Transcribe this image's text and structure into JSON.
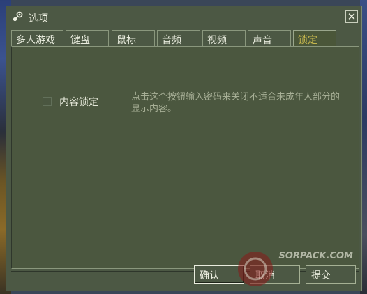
{
  "window": {
    "title": "选项",
    "close_glyph": "✕"
  },
  "tabs": [
    {
      "label": "多人游戏",
      "active": false
    },
    {
      "label": "键盘",
      "active": false
    },
    {
      "label": "鼠标",
      "active": false
    },
    {
      "label": "音频",
      "active": false
    },
    {
      "label": "视频",
      "active": false
    },
    {
      "label": "声音",
      "active": false
    },
    {
      "label": "锁定",
      "active": true
    }
  ],
  "lock": {
    "checkbox_label": "内容锁定",
    "checked": false,
    "description": "点击这个按钮输入密码来关闭不适合未成年人部分的显示内容。"
  },
  "buttons": {
    "ok": "确认",
    "cancel": "取消",
    "apply": "提交"
  },
  "watermark": {
    "text": "SORPACK.COM"
  },
  "icons": {
    "app": "steam-icon",
    "close": "close-icon"
  },
  "colors": {
    "dialog_bg": "#4c5844",
    "active_tab_text": "#c4b54d",
    "text": "#e9ecde",
    "muted_text": "#a7af96"
  }
}
